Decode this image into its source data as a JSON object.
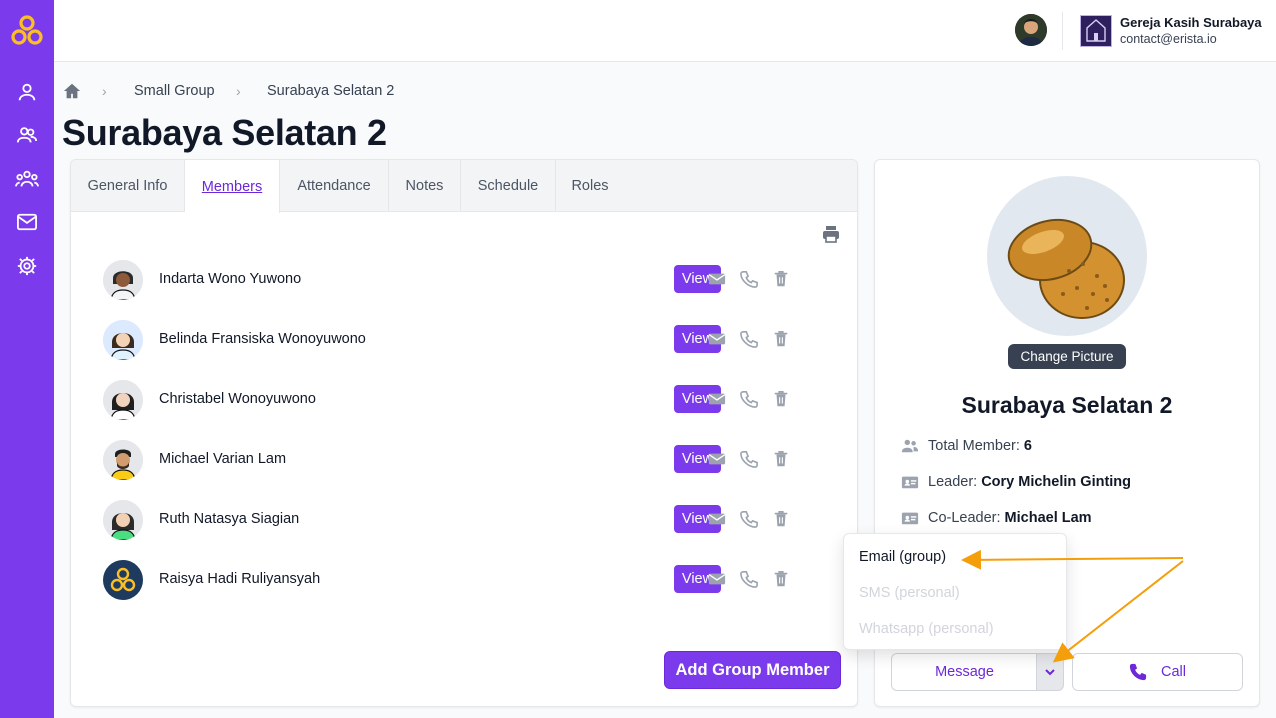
{
  "org": {
    "name": "Gereja Kasih Surabaya",
    "email": "contact@erista.io"
  },
  "breadcrumb": {
    "level1": "Small Group",
    "level2": "Surabaya Selatan 2"
  },
  "page": {
    "title": "Surabaya Selatan 2"
  },
  "tabs": [
    "General Info",
    "Members",
    "Attendance",
    "Notes",
    "Schedule",
    "Roles"
  ],
  "active_tab": "Members",
  "members": [
    {
      "name": "Indarta Wono Yuwono"
    },
    {
      "name": "Belinda Fransiska Wonoyuwono"
    },
    {
      "name": "Christabel Wonoyuwono"
    },
    {
      "name": "Michael Varian Lam"
    },
    {
      "name": "Ruth Natasya Siagian"
    },
    {
      "name": "Raisya Hadi Ruliyansyah"
    }
  ],
  "view_label": "View",
  "add_member_label": "Add Group Member",
  "group": {
    "change_picture_label": "Change Picture",
    "name": "Surabaya Selatan 2",
    "total_member_label": "Total Member:",
    "total_member_value": "6",
    "leader_label": "Leader:",
    "leader_value": "Cory Michelin Ginting",
    "coleader_label": "Co-Leader:",
    "coleader_value": "Michael Lam"
  },
  "actions": {
    "message_label": "Message",
    "call_label": "Call"
  },
  "message_menu": {
    "items": [
      {
        "label": "Email (group)",
        "enabled": true
      },
      {
        "label": "SMS (personal)",
        "enabled": false
      },
      {
        "label": "Whatsapp (personal)",
        "enabled": false
      }
    ]
  },
  "colors": {
    "primary": "#7c3aed",
    "annotation_arrow": "#f59e0b"
  },
  "icons": [
    "logo-icon",
    "person-icon",
    "people-icon",
    "group-icon",
    "mail-icon",
    "gear-icon",
    "home-icon",
    "print-icon",
    "envelope-icon",
    "phone-icon",
    "trash-icon",
    "chevron-down-icon",
    "id-card-icon"
  ]
}
